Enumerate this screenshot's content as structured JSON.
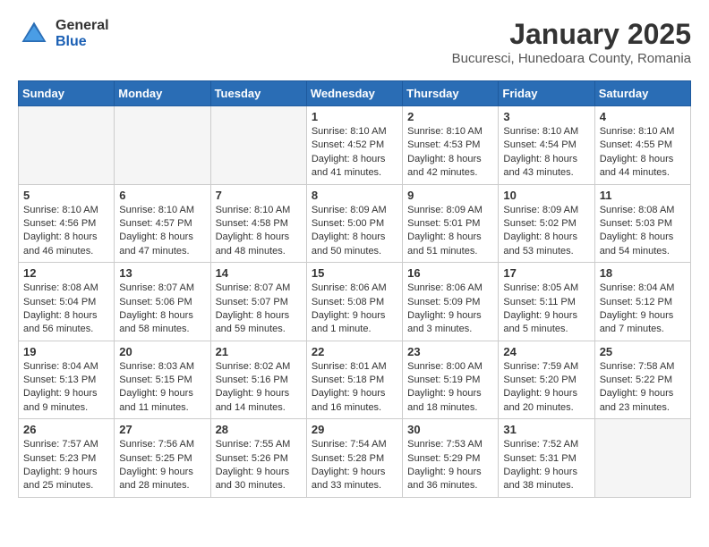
{
  "logo": {
    "general": "General",
    "blue": "Blue"
  },
  "title": "January 2025",
  "subtitle": "Bucuresci, Hunedoara County, Romania",
  "weekdays": [
    "Sunday",
    "Monday",
    "Tuesday",
    "Wednesday",
    "Thursday",
    "Friday",
    "Saturday"
  ],
  "weeks": [
    [
      {
        "day": "",
        "info": ""
      },
      {
        "day": "",
        "info": ""
      },
      {
        "day": "",
        "info": ""
      },
      {
        "day": "1",
        "info": "Sunrise: 8:10 AM\nSunset: 4:52 PM\nDaylight: 8 hours\nand 41 minutes."
      },
      {
        "day": "2",
        "info": "Sunrise: 8:10 AM\nSunset: 4:53 PM\nDaylight: 8 hours\nand 42 minutes."
      },
      {
        "day": "3",
        "info": "Sunrise: 8:10 AM\nSunset: 4:54 PM\nDaylight: 8 hours\nand 43 minutes."
      },
      {
        "day": "4",
        "info": "Sunrise: 8:10 AM\nSunset: 4:55 PM\nDaylight: 8 hours\nand 44 minutes."
      }
    ],
    [
      {
        "day": "5",
        "info": "Sunrise: 8:10 AM\nSunset: 4:56 PM\nDaylight: 8 hours\nand 46 minutes."
      },
      {
        "day": "6",
        "info": "Sunrise: 8:10 AM\nSunset: 4:57 PM\nDaylight: 8 hours\nand 47 minutes."
      },
      {
        "day": "7",
        "info": "Sunrise: 8:10 AM\nSunset: 4:58 PM\nDaylight: 8 hours\nand 48 minutes."
      },
      {
        "day": "8",
        "info": "Sunrise: 8:09 AM\nSunset: 5:00 PM\nDaylight: 8 hours\nand 50 minutes."
      },
      {
        "day": "9",
        "info": "Sunrise: 8:09 AM\nSunset: 5:01 PM\nDaylight: 8 hours\nand 51 minutes."
      },
      {
        "day": "10",
        "info": "Sunrise: 8:09 AM\nSunset: 5:02 PM\nDaylight: 8 hours\nand 53 minutes."
      },
      {
        "day": "11",
        "info": "Sunrise: 8:08 AM\nSunset: 5:03 PM\nDaylight: 8 hours\nand 54 minutes."
      }
    ],
    [
      {
        "day": "12",
        "info": "Sunrise: 8:08 AM\nSunset: 5:04 PM\nDaylight: 8 hours\nand 56 minutes."
      },
      {
        "day": "13",
        "info": "Sunrise: 8:07 AM\nSunset: 5:06 PM\nDaylight: 8 hours\nand 58 minutes."
      },
      {
        "day": "14",
        "info": "Sunrise: 8:07 AM\nSunset: 5:07 PM\nDaylight: 8 hours\nand 59 minutes."
      },
      {
        "day": "15",
        "info": "Sunrise: 8:06 AM\nSunset: 5:08 PM\nDaylight: 9 hours\nand 1 minute."
      },
      {
        "day": "16",
        "info": "Sunrise: 8:06 AM\nSunset: 5:09 PM\nDaylight: 9 hours\nand 3 minutes."
      },
      {
        "day": "17",
        "info": "Sunrise: 8:05 AM\nSunset: 5:11 PM\nDaylight: 9 hours\nand 5 minutes."
      },
      {
        "day": "18",
        "info": "Sunrise: 8:04 AM\nSunset: 5:12 PM\nDaylight: 9 hours\nand 7 minutes."
      }
    ],
    [
      {
        "day": "19",
        "info": "Sunrise: 8:04 AM\nSunset: 5:13 PM\nDaylight: 9 hours\nand 9 minutes."
      },
      {
        "day": "20",
        "info": "Sunrise: 8:03 AM\nSunset: 5:15 PM\nDaylight: 9 hours\nand 11 minutes."
      },
      {
        "day": "21",
        "info": "Sunrise: 8:02 AM\nSunset: 5:16 PM\nDaylight: 9 hours\nand 14 minutes."
      },
      {
        "day": "22",
        "info": "Sunrise: 8:01 AM\nSunset: 5:18 PM\nDaylight: 9 hours\nand 16 minutes."
      },
      {
        "day": "23",
        "info": "Sunrise: 8:00 AM\nSunset: 5:19 PM\nDaylight: 9 hours\nand 18 minutes."
      },
      {
        "day": "24",
        "info": "Sunrise: 7:59 AM\nSunset: 5:20 PM\nDaylight: 9 hours\nand 20 minutes."
      },
      {
        "day": "25",
        "info": "Sunrise: 7:58 AM\nSunset: 5:22 PM\nDaylight: 9 hours\nand 23 minutes."
      }
    ],
    [
      {
        "day": "26",
        "info": "Sunrise: 7:57 AM\nSunset: 5:23 PM\nDaylight: 9 hours\nand 25 minutes."
      },
      {
        "day": "27",
        "info": "Sunrise: 7:56 AM\nSunset: 5:25 PM\nDaylight: 9 hours\nand 28 minutes."
      },
      {
        "day": "28",
        "info": "Sunrise: 7:55 AM\nSunset: 5:26 PM\nDaylight: 9 hours\nand 30 minutes."
      },
      {
        "day": "29",
        "info": "Sunrise: 7:54 AM\nSunset: 5:28 PM\nDaylight: 9 hours\nand 33 minutes."
      },
      {
        "day": "30",
        "info": "Sunrise: 7:53 AM\nSunset: 5:29 PM\nDaylight: 9 hours\nand 36 minutes."
      },
      {
        "day": "31",
        "info": "Sunrise: 7:52 AM\nSunset: 5:31 PM\nDaylight: 9 hours\nand 38 minutes."
      },
      {
        "day": "",
        "info": ""
      }
    ]
  ]
}
